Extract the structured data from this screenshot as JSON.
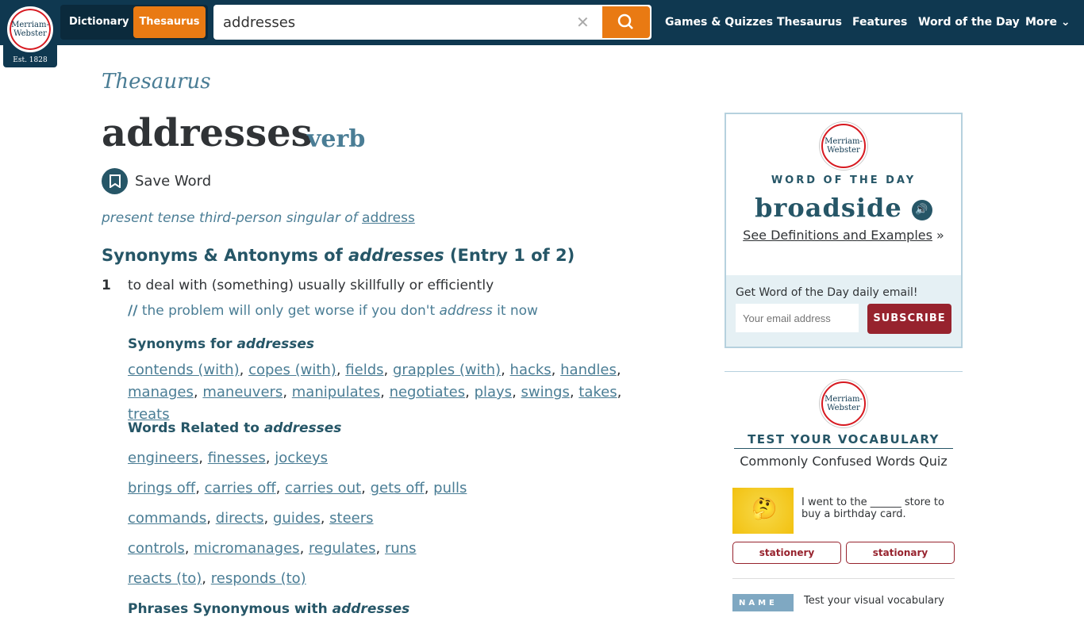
{
  "header": {
    "logo_text": "Merriam-Webster",
    "logo_est": "Est. 1828",
    "dictionary_tab": "Dictionary",
    "thesaurus_tab": "Thesaurus",
    "search_value": "addresses",
    "nav": [
      "Games & Quizzes",
      "Thesaurus",
      "Features",
      "Word of the Day",
      "More"
    ]
  },
  "entry": {
    "section": "Thesaurus",
    "word": "addresses",
    "pos": "verb",
    "save_label": "Save Word",
    "gloss_prefix": "present tense third-person singular of",
    "gloss_link": "address",
    "heading_pre": "Synonyms & Antonyms of",
    "heading_word": "addresses",
    "heading_post": "(Entry 1 of 2)",
    "sense_num": "1",
    "definition": "to deal with (something) usually skillfully or efficiently",
    "example_pre": "the problem will only get worse if you don't",
    "example_word": "address",
    "example_post": "it now",
    "synonyms_label": "Synonyms for",
    "synonyms": [
      "contends (with)",
      "copes (with)",
      "fields",
      "grapples (with)",
      "hacks",
      "handles",
      "manages",
      "maneuvers",
      "manipulates",
      "negotiates",
      "plays",
      "swings",
      "takes",
      "treats"
    ],
    "related_label": "Words Related to",
    "related_groups": [
      [
        "engineers",
        "finesses",
        "jockeys"
      ],
      [
        "brings off",
        "carries off",
        "carries out",
        "gets off",
        "pulls"
      ],
      [
        "commands",
        "directs",
        "guides",
        "steers"
      ],
      [
        "controls",
        "micromanages",
        "regulates",
        "runs"
      ],
      [
        "reacts (to)",
        "responds (to)"
      ]
    ],
    "phrases_label": "Phrases Synonymous with"
  },
  "wod": {
    "label": "WORD OF THE DAY",
    "word": "broadside",
    "link": "See Definitions and Examples",
    "email_prompt": "Get Word of the Day daily email!",
    "email_placeholder": "Your email address",
    "subscribe": "SUBSCRIBE"
  },
  "quiz": {
    "label": "TEST YOUR VOCABULARY",
    "title": "Commonly Confused Words Quiz",
    "question": "I went to the ______ store to buy a birthday card.",
    "options": [
      "stationery",
      "stationary"
    ],
    "next_text": "Test your visual vocabulary",
    "next_thumb": "NAME"
  },
  "colors": {
    "header": "#0f3850",
    "accent": "#e97a13",
    "heading": "#265667",
    "link": "#4a7d95",
    "subscribe": "#97232e"
  }
}
